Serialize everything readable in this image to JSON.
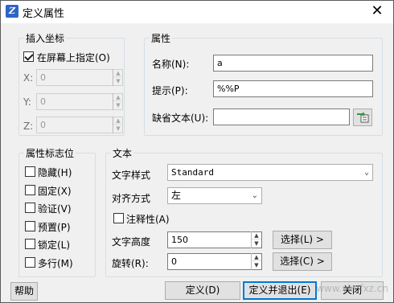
{
  "window": {
    "title": "定义属性",
    "close": "✕"
  },
  "insert_point": {
    "title": "插入坐标",
    "on_screen_label": "在屏幕上指定(O)",
    "on_screen_checked": true,
    "x_label": "X:",
    "x_value": "0",
    "y_label": "Y:",
    "y_value": "0",
    "z_label": "Z:",
    "z_value": "0"
  },
  "attribute": {
    "title": "属性",
    "name_label": "名称(N):",
    "name_value": "a",
    "prompt_label": "提示(P):",
    "prompt_value": "%%P",
    "default_label": "缺省文本(U):",
    "default_value": ""
  },
  "flags": {
    "title": "属性标志位",
    "items": [
      {
        "label": "隐藏(H)",
        "checked": false
      },
      {
        "label": "固定(X)",
        "checked": false
      },
      {
        "label": "验证(V)",
        "checked": false
      },
      {
        "label": "预置(P)",
        "checked": false
      },
      {
        "label": "锁定(L)",
        "checked": false
      },
      {
        "label": "多行(M)",
        "checked": false
      }
    ]
  },
  "text": {
    "title": "文本",
    "style_label": "文字样式",
    "style_value": "Standard",
    "align_label": "对齐方式",
    "align_value": "左",
    "annotative_label": "注释性(A)",
    "height_label": "文字高度",
    "height_value": "150",
    "height_pick": "选择(L) >",
    "rotation_label": "旋转(R):",
    "rotation_value": "0",
    "rotation_pick": "选择(C) >"
  },
  "footer": {
    "help": "帮助",
    "ok": "定义(D)",
    "ok_exit": "定义并退出(E)",
    "cancel": "关闭"
  },
  "watermark": "www.ylmfxz.cn"
}
